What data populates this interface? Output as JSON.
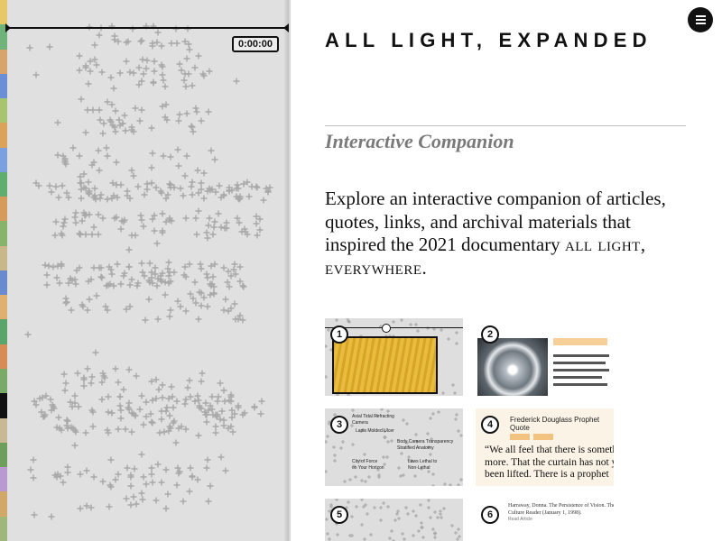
{
  "player": {
    "timer": "0:00:00",
    "strip_colors": [
      "#e8c766",
      "#6fb27a",
      "#d9a46b",
      "#6b8fd6",
      "#a9c46e",
      "#dba35a",
      "#7ba0e0",
      "#5fae6e",
      "#d69a5a",
      "#88b36a",
      "#c9b78a",
      "#6a8ad0",
      "#e0b070",
      "#5aa66a",
      "#d88c55",
      "#7aaa68",
      "#111111",
      "#c8b896",
      "#6d9e5c",
      "#b89ad0",
      "#d2a868",
      "#9fb77a"
    ]
  },
  "header": {
    "title": "ALL LIGHT, EXPANDED",
    "menu_icon": "hamburger-menu-icon"
  },
  "main": {
    "subtitle": "Interactive Companion",
    "intro_prefix": "Explore an interactive companion of articles, quotes, links, and archival materials that inspired the 2021 documentary",
    "intro_film": "all light, everywhere",
    "intro_suffix": "."
  },
  "thumbnails": [
    {
      "number": "1",
      "kind": "video"
    },
    {
      "number": "2",
      "kind": "halo"
    },
    {
      "number": "3",
      "kind": "map",
      "labels": [
        "Axial Tidal Refracting",
        "Camera",
        "Lapis Molded Ulcer",
        "Body Camera Transparency",
        "Stratified Anatomy",
        "City of Force",
        "on Your Horizon",
        "Laws Lethal to",
        "Non-Lethal"
      ]
    },
    {
      "number": "4",
      "kind": "quote",
      "heading": "Frederick Douglass Prophet",
      "heading2": "Quote",
      "quote_lines": [
        "“We all feel that there is somethin",
        "more. That the curtain has not ye",
        "been lifted. There is a prophet"
      ]
    },
    {
      "number": "5",
      "kind": "map"
    },
    {
      "number": "6",
      "kind": "citation",
      "cite_lines": [
        "Harraway, Donna. The Persistence of Vision. The Visual",
        "Culture Reader (January 1, 1998)."
      ],
      "small": "Read Article"
    }
  ]
}
